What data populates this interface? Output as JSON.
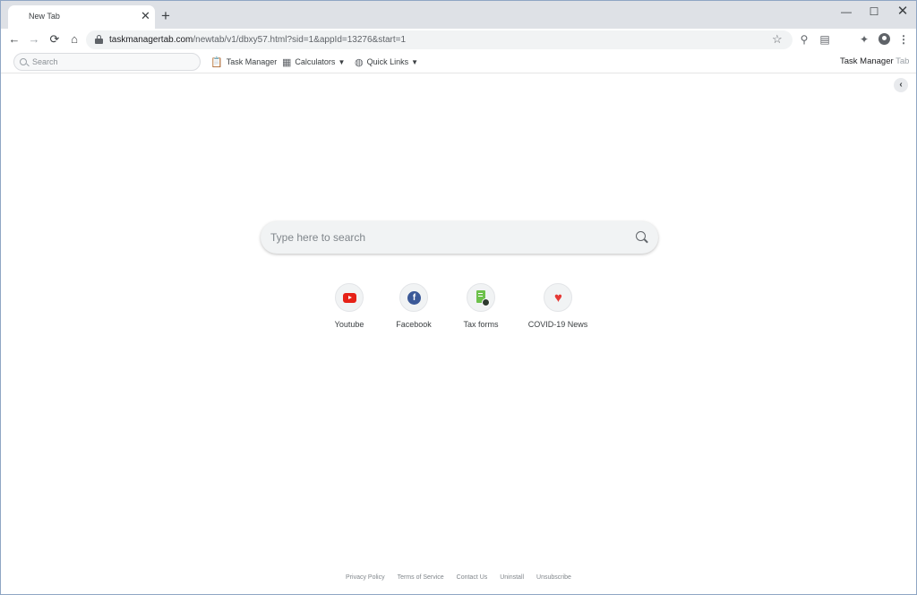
{
  "browser": {
    "tab_title": "New Tab",
    "tab_close": "✕",
    "new_tab": "+",
    "window_controls": {
      "minimize": "—",
      "maximize": "☐",
      "close": "✕"
    },
    "url_host": "taskmanagertab.com",
    "url_path": "/newtab/v1/dbxy57.html?sid=1&appId=13276&start=1",
    "nav": {
      "back": "←",
      "forward": "→",
      "reload": "⟳",
      "home": "⌂"
    },
    "icons": [
      "lock-icon",
      "star-icon",
      "zoom-icon",
      "reader-icon",
      "extensions-icon",
      "profile-icon",
      "menu-icon"
    ]
  },
  "extension_bar": {
    "search_placeholder": "Search",
    "items": [
      {
        "label": "Task Manager",
        "icon": "clipboard-icon"
      },
      {
        "label": "Calculators",
        "icon": "calculator-icon"
      },
      {
        "label": "Quick Links",
        "icon": "globe-icon"
      }
    ],
    "brand": {
      "main": "Task Manager",
      "suffix": "Tab"
    }
  },
  "main": {
    "search_placeholder": "Type here to search",
    "shortcuts": [
      {
        "label": "Youtube",
        "icon": "youtube-icon"
      },
      {
        "label": "Facebook",
        "icon": "facebook-icon"
      },
      {
        "label": "Tax forms",
        "icon": "tax-forms-icon"
      },
      {
        "label": "COVID-19 News",
        "icon": "heart-icon"
      }
    ]
  },
  "footer": {
    "links": [
      "Privacy Policy",
      "Terms of Service",
      "Contact Us",
      "Uninstall",
      "Unsubscribe"
    ]
  },
  "colors": {
    "tabstrip": "#dee1e6",
    "youtube": "#e62117",
    "facebook": "#3b5998",
    "tax": "#6dc14b",
    "covid": "#e53935"
  }
}
